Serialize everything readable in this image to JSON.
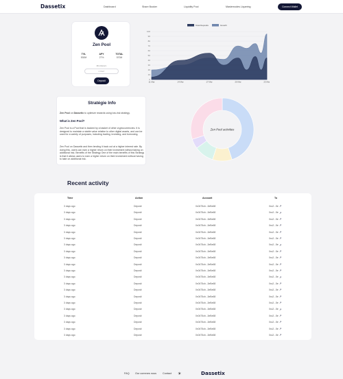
{
  "brand": "Dassetix",
  "nav": {
    "links": [
      "Dashboard",
      "Share Booker",
      "Liquidity Pool",
      "Masternodes Liquering"
    ],
    "connect_label": "Connect Wallet"
  },
  "pool": {
    "name": "Zen Pool",
    "stats": [
      {
        "label": "TVL",
        "value": "530M"
      },
      {
        "label": "APY",
        "value": "27%"
      },
      {
        "label": "TOTAL",
        "value": "570M"
      }
    ],
    "min_label": "Min Return",
    "amount_placeholder": "0 DEP",
    "deposit_label": "Deposit"
  },
  "chart_data": {
    "type": "area",
    "legend": [
      "Total Deposits",
      "Growth"
    ],
    "x": [
      "11 Mar",
      "14 Mar",
      "17 Mar",
      "20 Mar",
      "23 Mar"
    ],
    "ylim": [
      0,
      100
    ],
    "yticks": [
      0,
      10,
      20,
      30,
      40,
      50,
      60,
      70,
      80,
      90,
      100
    ],
    "series": [
      {
        "name": "Total Deposits",
        "values": [
          5,
          40,
          55,
          30,
          45,
          20,
          48,
          20,
          45
        ],
        "color": "#2d3b5f"
      },
      {
        "name": "Growth",
        "values": [
          20,
          30,
          45,
          42,
          70,
          65,
          75,
          55,
          95
        ],
        "color": "#6f86ad"
      }
    ],
    "xpos": [
      0,
      0.25,
      0.5,
      0.625,
      0.75,
      0.825,
      0.9,
      0.95,
      1
    ]
  },
  "donut": {
    "label": "Zen Pool activities",
    "slices": [
      {
        "value": 45,
        "color": "#c9dcf7"
      },
      {
        "value": 10,
        "color": "#fbf1cf"
      },
      {
        "value": 10,
        "color": "#d8f3ec"
      },
      {
        "value": 5,
        "color": "#e3dcfa"
      },
      {
        "value": 30,
        "color": "#fbdce8"
      }
    ]
  },
  "info": {
    "title": "Stratégie Info",
    "intro_a": "Zen Pool",
    "intro_b": " on ",
    "intro_c": "Dassetix",
    "intro_d": " to optimize rewards using low-risk strategy.",
    "question": "What is Zen Pool?",
    "p1": "Zen Pool is a Pool that is backed by a basket of other cryptocurrencies. It is designed to maintain a stable value relative to other digital assets, and can be used for a variety of purposes, including trading, investing, and borrowing.",
    "p2": "Zen Pool on Dassetix and then lending it back out at a higher interest rate. By doing this, users can earn a higher return on their investment without taking on additional risk. Benefits of the Strategy One of the main benefits of this Strategy is that it allows users to earn a higher return on their investment without having to take on additional risk."
  },
  "recent": {
    "title": "Recent activity",
    "headers": [
      "Time",
      "Action",
      "Account",
      "To"
    ],
    "rows": [
      [
        "3 days ago",
        "Deposit",
        "0x0475cb...3eBe68",
        "0xc2...5e"
      ],
      [
        "3 days ago",
        "Deposit",
        "0x0475cb...3eBe68",
        "0xc2...5e"
      ],
      [
        "3 days ago",
        "Deposit",
        "0x0475cb...3eBe68",
        "0xc2...5e"
      ],
      [
        "3 days ago",
        "Deposit",
        "0x0475cb...3eBe68",
        "0xc2...5e"
      ],
      [
        "3 days ago",
        "Deposit",
        "0x0475cb...3eBe68",
        "0xc2...5e"
      ],
      [
        "3 days ago",
        "Deposit",
        "0x0475cb...3eBe68",
        "0xc2...5e"
      ],
      [
        "3 days ago",
        "Deposit",
        "0x0475cb...3eBe68",
        "0xc2...5e"
      ],
      [
        "3 days ago",
        "Deposit",
        "0x0475cb...3eBe68",
        "0xc2...5e"
      ],
      [
        "3 days ago",
        "Deposit",
        "0x0475cb...3eBe68",
        "0xc2...5e"
      ],
      [
        "3 days ago",
        "Deposit",
        "0x0475cb...3eBe68",
        "0xc2...5e"
      ],
      [
        "3 days ago",
        "Deposit",
        "0x0475cb...3eBe68",
        "0xc2...5e"
      ],
      [
        "3 days ago",
        "Deposit",
        "0x0475cb...3eBe68",
        "0xc2...5e"
      ],
      [
        "3 days ago",
        "Deposit",
        "0x0475cb...3eBe68",
        "0xc2...5e"
      ],
      [
        "3 days ago",
        "Deposit",
        "0x0475cb...3eBe68",
        "0xc2...5e"
      ],
      [
        "3 days ago",
        "Deposit",
        "0x0475cb...3eBe68",
        "0xc2...5e"
      ],
      [
        "3 days ago",
        "Deposit",
        "0x0475cb...3eBe68",
        "0xc2...5e"
      ],
      [
        "3 days ago",
        "Deposit",
        "0x0475cb...3eBe68",
        "0xc2...5e"
      ],
      [
        "3 days ago",
        "Deposit",
        "0x0475cb...3eBe68",
        "0xc2...5e"
      ],
      [
        "3 days ago",
        "Deposit",
        "0x0475cb...3eBe68",
        "0xc2...5e"
      ],
      [
        "3 days ago",
        "Deposit",
        "0x0475cb...3eBe68",
        "0xc2...5e"
      ],
      [
        "3 days ago",
        "Deposit",
        "0x0475cb...3eBe68",
        "0xc2...5e"
      ]
    ]
  },
  "footer": {
    "links": [
      "FAQ",
      "Our commes nous",
      "Contact"
    ]
  }
}
